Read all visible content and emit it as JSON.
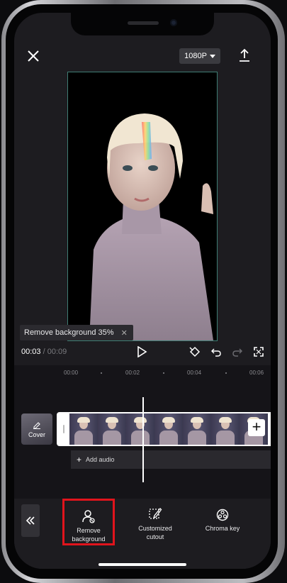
{
  "header": {
    "resolution_label": "1080P",
    "close_icon": "close-icon",
    "export_icon": "upload-icon"
  },
  "preview": {
    "progress_label": "Remove background 35%",
    "progress_percent": 35
  },
  "playback": {
    "current_time": "00:03",
    "separator": "/",
    "total_time": "00:09"
  },
  "timeline": {
    "ruler_ticks": [
      "00:00",
      "00:02",
      "00:04",
      "00:06"
    ],
    "cover_label": "Cover",
    "add_audio_label": "Add audio",
    "add_clip_symbol": "+"
  },
  "toolbar": {
    "back_icon": "double-chevron-left-icon",
    "tools": [
      {
        "label": "Remove background",
        "icon": "person-remove-icon",
        "highlighted": true
      },
      {
        "label": "Customized cutout",
        "icon": "brush-select-icon",
        "highlighted": false
      },
      {
        "label": "Chroma key",
        "icon": "chroma-key-icon",
        "highlighted": false
      }
    ]
  },
  "colors": {
    "highlight": "#e1141c",
    "preview_border": "#3f7d73",
    "background": "#1d1c20"
  }
}
